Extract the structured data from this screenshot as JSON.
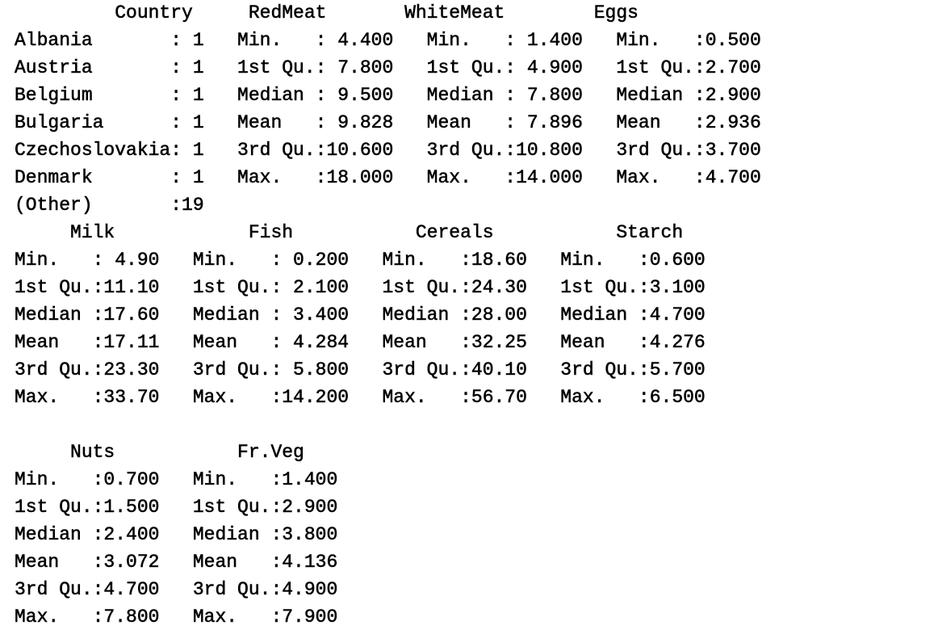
{
  "console": {
    "lines": [
      "         Country     RedMeat       WhiteMeat        Eggs     ",
      "Albania       : 1   Min.   : 4.400   Min.   : 1.400   Min.   :0.500  ",
      "Austria       : 1   1st Qu.: 7.800   1st Qu.: 4.900   1st Qu.:2.700  ",
      "Belgium       : 1   Median : 9.500   Median : 7.800   Median :2.900  ",
      "Bulgaria      : 1   Mean   : 9.828   Mean   : 7.896   Mean   :2.936  ",
      "Czechoslovakia: 1   3rd Qu.:10.600   3rd Qu.:10.800   3rd Qu.:3.700  ",
      "Denmark       : 1   Max.   :18.000   Max.   :14.000   Max.   :4.700  ",
      "(Other)       :19                                                    ",
      "     Milk            Fish           Cereals           Starch     ",
      "Min.   : 4.90   Min.   : 0.200   Min.   :18.60   Min.   :0.600  ",
      "1st Qu.:11.10   1st Qu.: 2.100   1st Qu.:24.30   1st Qu.:3.100  ",
      "Median :17.60   Median : 3.400   Median :28.00   Median :4.700  ",
      "Mean   :17.11   Mean   : 4.284   Mean   :32.25   Mean   :4.276  ",
      "3rd Qu.:23.30   3rd Qu.: 5.800   3rd Qu.:40.10   3rd Qu.:5.700  ",
      "Max.   :33.70   Max.   :14.200   Max.   :56.70   Max.   :6.500  ",
      "",
      "     Nuts           Fr.Veg     ",
      "Min.   :0.700   Min.   :1.400  ",
      "1st Qu.:1.500   1st Qu.:2.900  ",
      "Median :2.400   Median :3.800  ",
      "Mean   :3.072   Mean   :4.136  ",
      "3rd Qu.:4.700   3rd Qu.:4.900  ",
      "Max.   :7.800   Max.   :7.900  "
    ]
  }
}
